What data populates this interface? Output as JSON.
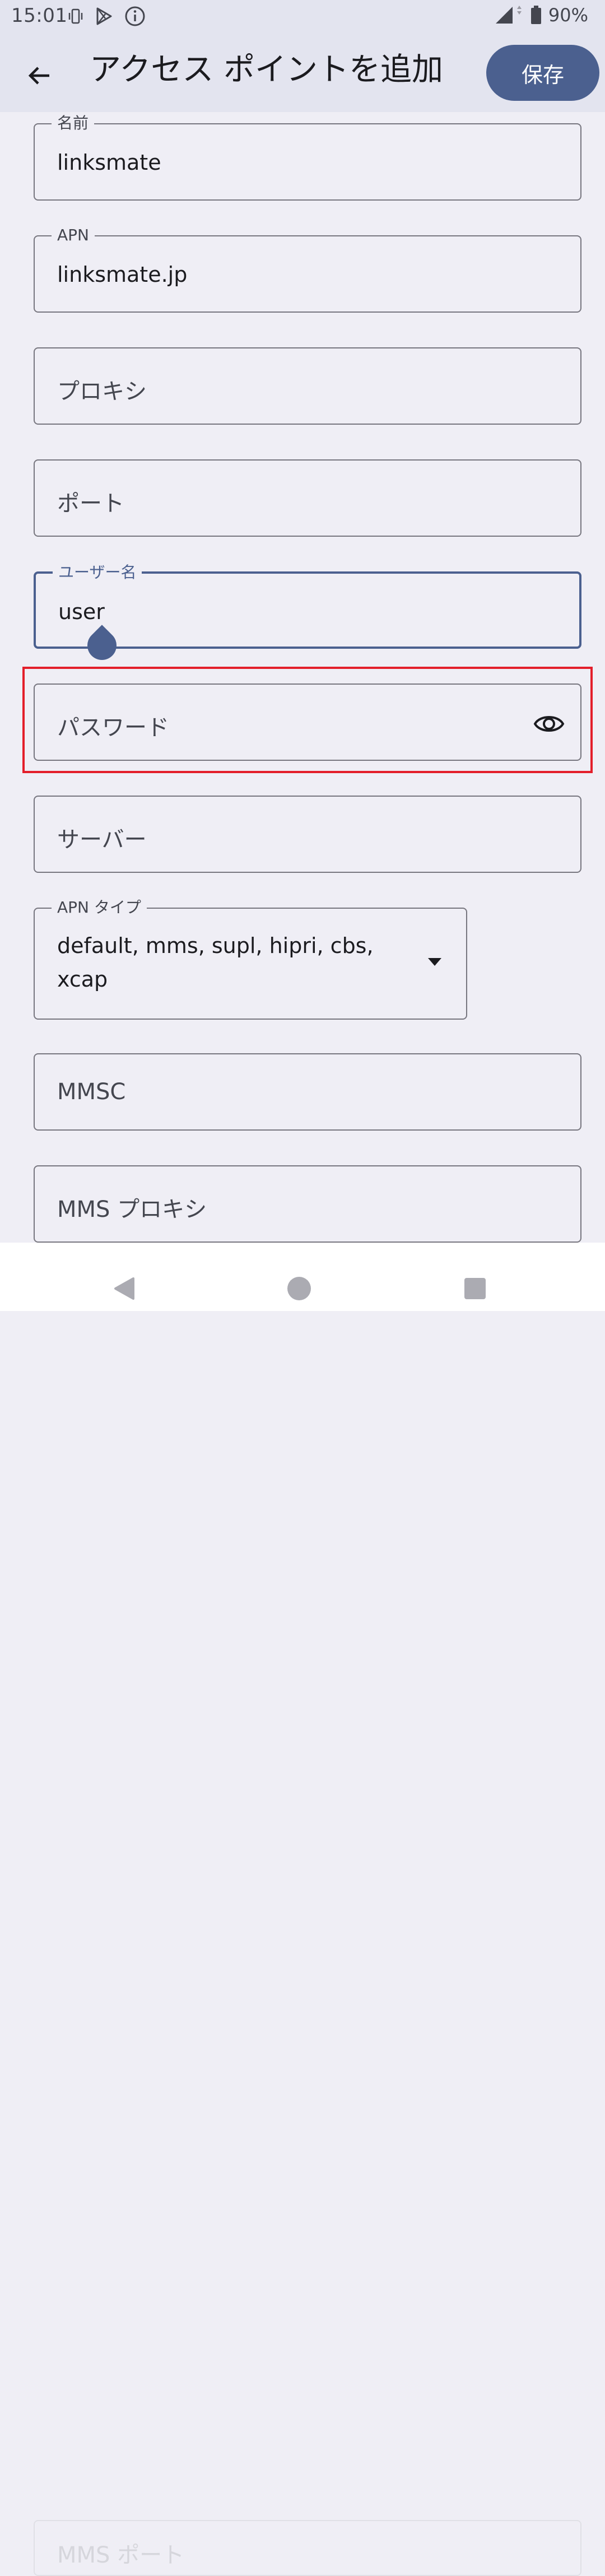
{
  "status_bar": {
    "time": "15:01",
    "battery": "90%"
  },
  "app_bar": {
    "title": "アクセス ポイントを追加",
    "save_label": "保存"
  },
  "fields": {
    "name": {
      "label": "名前",
      "value": "linksmate"
    },
    "apn": {
      "label": "APN",
      "value": "linksmate.jp"
    },
    "proxy": {
      "placeholder": "プロキシ"
    },
    "port": {
      "placeholder": "ポート"
    },
    "username": {
      "label": "ユーザー名",
      "value": "user"
    },
    "password": {
      "placeholder": "パスワード"
    },
    "server": {
      "placeholder": "サーバー"
    },
    "apn_type": {
      "label": "APN タイプ",
      "value_line1": "default, mms, supl, hipri, cbs,",
      "value_line2": "xcap"
    },
    "mmsc": {
      "placeholder": "MMSC"
    },
    "mms_proxy": {
      "placeholder": "MMS プロキシ"
    },
    "mms_port_partial": {
      "placeholder": "MMS ポート"
    }
  },
  "colors": {
    "primary": "#4b608f",
    "highlight": "#e31e2a",
    "background": "#efeef5",
    "app_bar_bg": "#e3e4ef"
  },
  "icons": {
    "back": "arrow-left-icon",
    "eye": "eye-icon",
    "dropdown": "dropdown-arrow-icon",
    "nav_back": "triangle-back-icon",
    "nav_home": "circle-home-icon",
    "nav_recents": "square-recents-icon"
  }
}
